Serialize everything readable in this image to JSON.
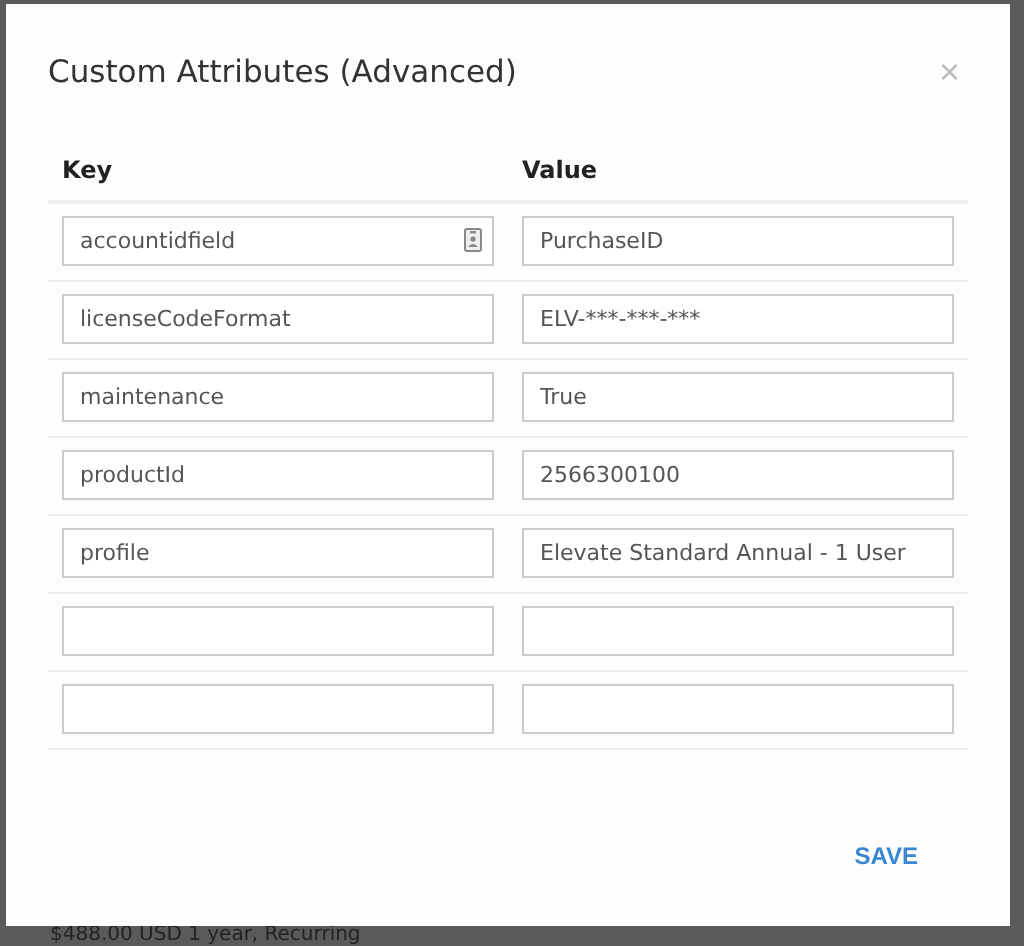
{
  "dialog": {
    "title": "Custom Attributes (Advanced)",
    "close": "×",
    "columns": [
      "Key",
      "Value"
    ],
    "rows": [
      {
        "key": "accountidfield",
        "value": "PurchaseID",
        "autofill_icon": true
      },
      {
        "key": "licenseCodeFormat",
        "value": "ELV-***-***-***",
        "autofill_icon": false
      },
      {
        "key": "maintenance",
        "value": "True",
        "autofill_icon": false
      },
      {
        "key": "productId",
        "value": "2566300100",
        "autofill_icon": false
      },
      {
        "key": "profile",
        "value": "Elevate Standard Annual - 1 User",
        "autofill_icon": false
      },
      {
        "autofill_icon": false
      },
      {
        "autofill_icon": false
      }
    ],
    "save": "SAVE"
  },
  "background_text": "$488.00 USD  1 year, Recurring"
}
